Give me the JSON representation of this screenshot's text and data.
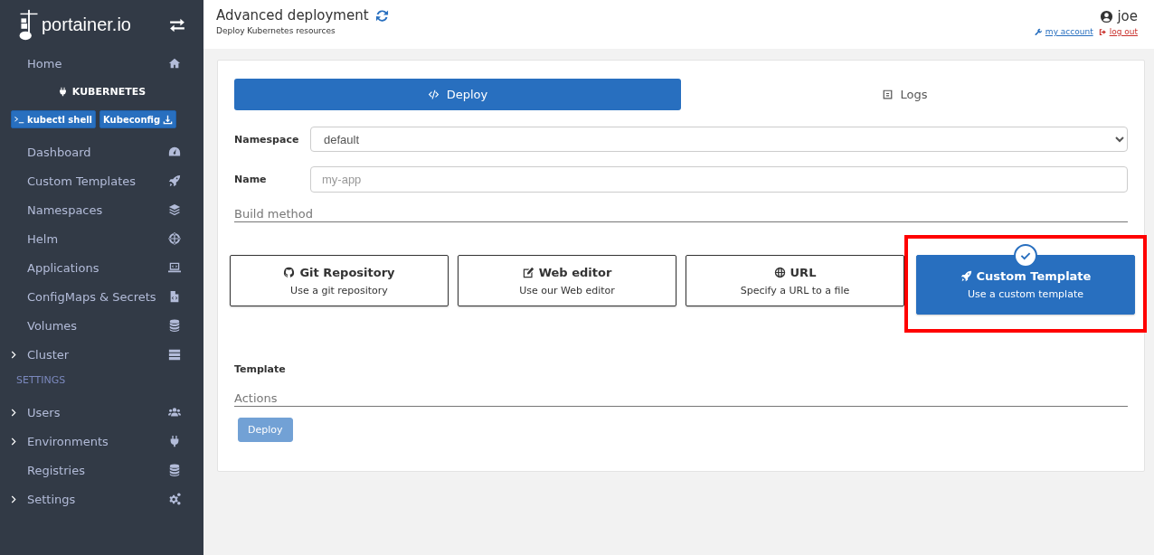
{
  "sidebar": {
    "logo": "portainer.io",
    "home": {
      "label": "Home"
    },
    "environment": {
      "label": "KUBERNETES"
    },
    "env_buttons": [
      {
        "label": "kubectl shell"
      },
      {
        "label": "Kubeconfig"
      }
    ],
    "items": [
      {
        "label": "Dashboard"
      },
      {
        "label": "Custom Templates"
      },
      {
        "label": "Namespaces"
      },
      {
        "label": "Helm"
      },
      {
        "label": "Applications"
      },
      {
        "label": "ConfigMaps & Secrets"
      },
      {
        "label": "Volumes"
      },
      {
        "label": "Cluster",
        "expanded": false
      }
    ],
    "settings_heading": "SETTINGS",
    "settings_items": [
      {
        "label": "Users",
        "expanded": false
      },
      {
        "label": "Environments",
        "expanded": false
      },
      {
        "label": "Registries"
      },
      {
        "label": "Settings",
        "expanded": false
      }
    ]
  },
  "header": {
    "title": "Advanced deployment",
    "subtitle": "Deploy Kubernetes resources",
    "user": "joe",
    "my_account": "my account",
    "log_out": "log out"
  },
  "tabs": [
    {
      "label": "Deploy",
      "selected": true
    },
    {
      "label": "Logs",
      "selected": false
    }
  ],
  "form": {
    "namespace": {
      "label": "Namespace",
      "value": "default"
    },
    "name": {
      "label": "Name",
      "placeholder": "my-app"
    }
  },
  "build_method": {
    "heading": "Build method",
    "options": [
      {
        "title": "Git Repository",
        "description": "Use a git repository",
        "selected": false,
        "highlighted": false
      },
      {
        "title": "Web editor",
        "description": "Use our Web editor",
        "selected": false,
        "highlighted": false
      },
      {
        "title": "URL",
        "description": "Specify a URL to a file",
        "selected": false,
        "highlighted": false
      },
      {
        "title": "Custom Template",
        "description": "Use a custom template",
        "selected": true,
        "highlighted": true
      }
    ]
  },
  "template_label": "Template",
  "actions": {
    "heading": "Actions",
    "button": {
      "label": "Deploy",
      "disabled": true
    }
  }
}
